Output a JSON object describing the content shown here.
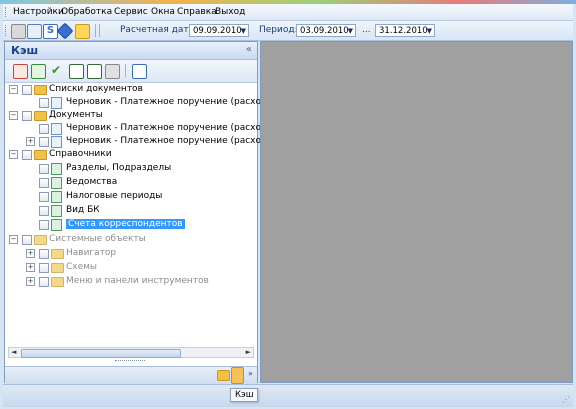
{
  "menubar": {
    "items": [
      "Настройки",
      "Обработка",
      "Сервис",
      "Окна",
      "Справка",
      "Выход"
    ]
  },
  "toolbar": {
    "calc_date_label": "Расчетная дата:",
    "calc_date_value": "09.09.2010",
    "period_label": "Период:",
    "period_from": "03.09.2010",
    "period_separator": "...",
    "period_to": "31.12.2010"
  },
  "panel": {
    "title": "Кэш",
    "collapse": "«",
    "tooltip": "Кэш"
  },
  "tree": {
    "items": [
      {
        "label": "Списки документов"
      },
      {
        "label": "Черновик - Платежное поручение (расходн"
      },
      {
        "label": "Документы"
      },
      {
        "label": "Черновик - Платежное поручение (расходн"
      },
      {
        "label": "Черновик - Платежное поручение (расходн"
      },
      {
        "label": "Справочники"
      },
      {
        "label": "Разделы, Подразделы"
      },
      {
        "label": "Ведомства"
      },
      {
        "label": "Налоговые периоды"
      },
      {
        "label": "Вид БК"
      },
      {
        "label": "Счета корреспондентов"
      },
      {
        "label": "Системные объекты"
      },
      {
        "label": "Навигатор"
      },
      {
        "label": "Схемы"
      },
      {
        "label": "Меню и панели инструментов"
      }
    ]
  },
  "colors": {
    "accent": "#15428b",
    "selection": "#3399ff",
    "workspace": "#a0a0a0"
  }
}
